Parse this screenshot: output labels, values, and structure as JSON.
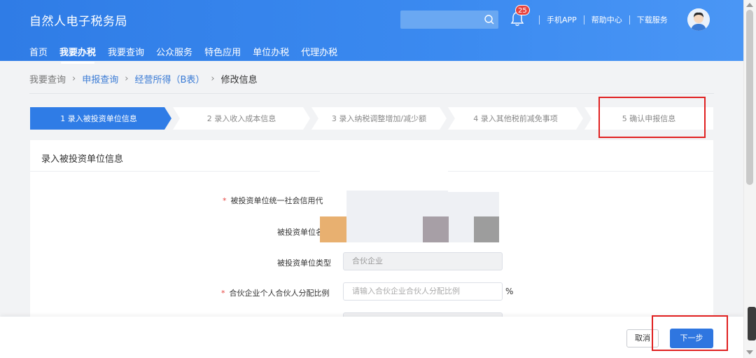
{
  "header": {
    "app_title": "自然人电子税务局",
    "notification_count": "25",
    "links": [
      "手机APP",
      "帮助中心",
      "下载服务"
    ],
    "nav": [
      {
        "label": "首页",
        "active": false
      },
      {
        "label": "我要办税",
        "active": true
      },
      {
        "label": "我要查询",
        "active": false
      },
      {
        "label": "公众服务",
        "active": false
      },
      {
        "label": "特色应用",
        "active": false
      },
      {
        "label": "单位办税",
        "active": false
      },
      {
        "label": "代理办税",
        "active": false
      }
    ]
  },
  "breadcrumb": {
    "items": [
      "我要查询",
      "申报查询",
      "经营所得（B表）",
      "修改信息"
    ]
  },
  "steps": [
    {
      "label": "1  录入被投资单位信息",
      "active": true
    },
    {
      "label": "2  录入收入成本信息",
      "active": false
    },
    {
      "label": "3  录入纳税调整增加/减少额",
      "active": false
    },
    {
      "label": "4  录入其他税前减免事项",
      "active": false
    },
    {
      "label": "5  确认申报信息",
      "active": false
    }
  ],
  "form": {
    "title": "录入被投资单位信息",
    "fields": {
      "credit_code_label": "被投资单位统一社会信用代",
      "unit_name_label": "被投资单位名",
      "unit_type_label": "被投资单位类型",
      "unit_type_value": "合伙企业",
      "ratio_label": "合伙企业个人合伙人分配比例",
      "ratio_placeholder": "请输入合伙企业合伙人分配比例",
      "ratio_unit": "%"
    }
  },
  "footer": {
    "cancel_label": "取消",
    "next_label": "下一步"
  },
  "colors": {
    "header_blue": "#2f7ce6",
    "primary_button": "#2f76e0",
    "active_step": "#2f7ce6",
    "highlight_red": "#e02020",
    "required_mark": "#e64340"
  }
}
